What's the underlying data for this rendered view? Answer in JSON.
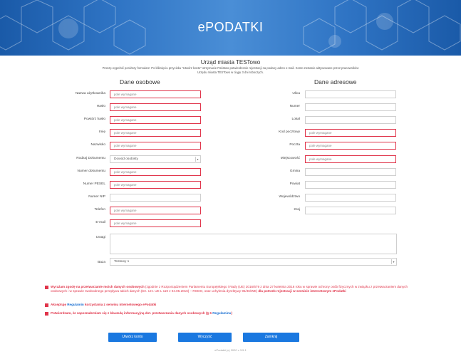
{
  "banner": {
    "title": "ePODATKI"
  },
  "office": "Urząd miasta TESTowo",
  "intro": "Proszę wypełnić poniższy formularz. Po kliknięciu przycisku \"Utwórz konto\" otrzymacie Państwo potwierdzenie rejestracji na podany adres e-mail. Konto zostanie aktywowane przez pracowników Urzędu miasta TESTowo w ciągu 3 dni roboczych.",
  "sections": {
    "personal": "Dane osobowe",
    "address": "Dane adresowe"
  },
  "placeholder": "pole wymagane",
  "personal": [
    {
      "label": "Nazwa użytkownika",
      "required": true
    },
    {
      "label": "Hasło",
      "required": true
    },
    {
      "label": "Powtórz hasło",
      "required": true
    },
    {
      "label": "Imię",
      "required": true
    },
    {
      "label": "Nazwisko",
      "required": true
    },
    {
      "label": "Rodzaj Dokumentu",
      "select": "Dowód osobisty"
    },
    {
      "label": "Numer dokumentu",
      "required": true
    },
    {
      "label": "Numer PESEL",
      "required": true
    },
    {
      "label": "Numer NIP",
      "required": false
    },
    {
      "label": "Telefon",
      "required": true
    },
    {
      "label": "E-mail",
      "required": true
    }
  ],
  "address": [
    {
      "label": "Ulica",
      "required": false
    },
    {
      "label": "Numer",
      "required": false
    },
    {
      "label": "Lokal",
      "required": false
    },
    {
      "label": "Kod pocztowy",
      "required": true
    },
    {
      "label": "Poczta",
      "required": true
    },
    {
      "label": "Miejscowość",
      "required": true
    },
    {
      "label": "Gmina",
      "required": false
    },
    {
      "label": "Powiat",
      "required": false
    },
    {
      "label": "Województwo",
      "required": false
    },
    {
      "label": "Kraj",
      "required": false
    }
  ],
  "notes_label": "Uwagi",
  "base_label": "Baza",
  "base_value": "Testowy 1",
  "agreements": {
    "a1_bold": "Wyrażam zgodę na przetwarzanie moich danych osobowych",
    "a1_text": " (zgodnie z Rozporządzeniem Parlamentu Europejskiego i Rady (UE) 2016/679 z dnia 27 kwietnia 2016 roku w sprawie ochrony osób fizycznych w związku z przetwarzaniem danych osobowych i w sprawie swobodnego przepływu takich danych (Dz. Urz. UE L 119 z 04.05.2016) – RODO, oraz uchylenia dyrektywy 95/46/WE) ",
    "a1_end": "dla potrzeb rejestracji w serwisie internetowym ePodatki",
    "a2_pre": "Akceptuję ",
    "a2_link": "Regulamin",
    "a2_post": " korzystania z serwisu internetowego ePodatki",
    "a3_pre": "Potwierdzam, że zapoznałem/am się z klauzulą informacyjną dot. przetwarzania danych osobowych (§ 6 ",
    "a3_link": "Regulaminu",
    "a3_post": ")"
  },
  "buttons": {
    "create": "Utwórz konto",
    "clear": "Wyczyść",
    "close": "Zamknij"
  },
  "footer": "ePodatki (c) 2020 v 3.5.1",
  "colors": {
    "accent": "#1a78e0",
    "required": "#e0344a",
    "banner": "#2f74c4"
  }
}
